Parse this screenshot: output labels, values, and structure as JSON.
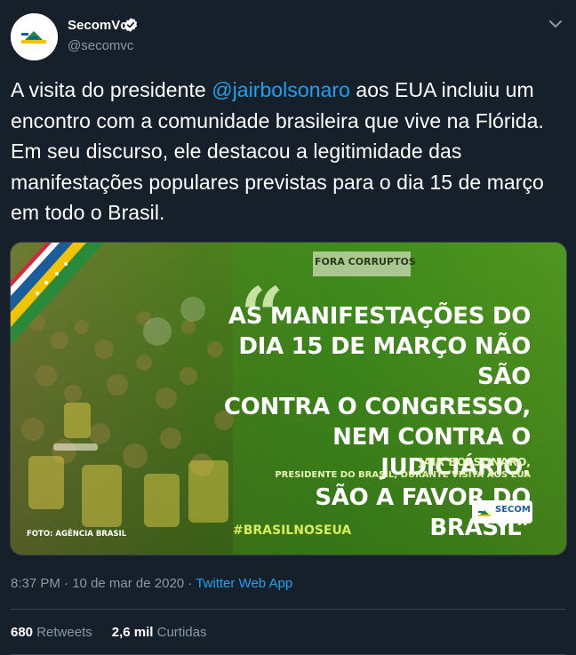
{
  "account": {
    "display_name": "SecomVc",
    "handle": "@secomvc",
    "verified_icon": "verified-badge-icon"
  },
  "tweet": {
    "text_before": "A visita do presidente ",
    "mention": "@jairbolsonaro",
    "text_after": " aos EUA incluiu um encontro com a comunidade brasileira que vive na Flórida. Em seu discurso, ele destacou a legitimidade das manifestações populares previstas para o dia 15 de março em todo o Brasil."
  },
  "media": {
    "open_quote": "“",
    "quote_lines": [
      "AS MANIFESTAÇÕES DO",
      "DIA 15 DE MARÇO NÃO SÃO",
      "CONTRA O CONGRESSO,",
      "NEM CONTRA O JUDICIÁRIO.",
      "SÃO A FAVOR DO BRASIL”"
    ],
    "credit_name": "JAIR BOLSONARO,",
    "credit_role": "PRESIDENTE DO BRASIL, DURANTE VISITA AOS EUA",
    "hashtag": "#BRASILNOSEUA",
    "photo_credit": "FOTO: AGÊNCIA BRASIL",
    "badge_text": "SECOM",
    "banner_text": "FORA CORRUPTOS",
    "colors": {
      "accent_green": "#3e6b14",
      "hashtag_yellow": "#d8ec5a"
    }
  },
  "meta": {
    "time": "8:37 PM",
    "separator": " · ",
    "date": "10 de mar de 2020",
    "source": "Twitter Web App"
  },
  "stats": {
    "retweets_count": "680",
    "retweets_label": "Retweets",
    "likes_count": "2,6 mil",
    "likes_label": "Curtidas"
  },
  "colors": {
    "background": "#15202b",
    "link_blue": "#1da1f2",
    "secondary_text": "#8899a6"
  }
}
